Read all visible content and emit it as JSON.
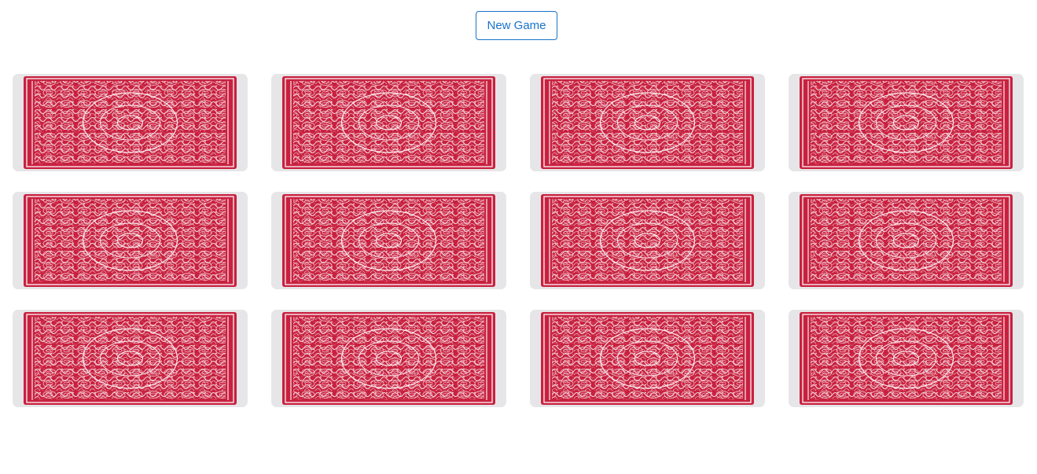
{
  "toolbar": {
    "new_game_label": "New Game"
  },
  "board": {
    "rows": 3,
    "columns": 4,
    "card_count": 12,
    "card_state": "face-down",
    "card_back_color": "#c8213f",
    "card_frame_color": "#e6e6e8"
  },
  "colors": {
    "accent": "#1a73c8",
    "background": "#ffffff"
  }
}
